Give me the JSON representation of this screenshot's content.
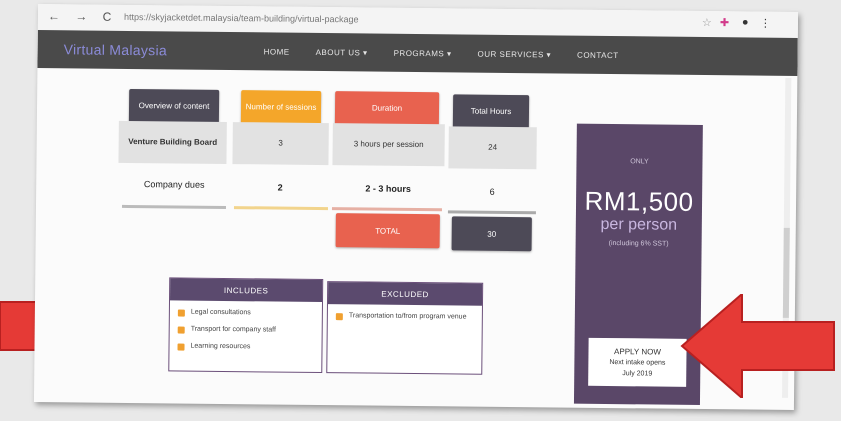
{
  "browser": {
    "url": "https://skyjacketdet.malaysia/team-building/virtual-package",
    "nav_glyphs": "← → C",
    "ext_icons": [
      "star-icon",
      "puzzle-icon",
      "profile-icon",
      "menu-icon"
    ]
  },
  "site": {
    "logo": "Virtual Malaysia",
    "menu": [
      "HOME",
      "ABOUT US ▾",
      "PROGRAMS ▾",
      "OUR SERVICES ▾",
      "CONTACT"
    ]
  },
  "table": {
    "headers": [
      "Overview of content",
      "Number of sessions",
      "Duration",
      "Total Hours"
    ],
    "row1": [
      "Venture Building Board",
      "3",
      "3 hours per session",
      "24"
    ],
    "row2": [
      "Company dues",
      "2",
      "2 - 3 hours",
      "6"
    ],
    "total_label": "TOTAL",
    "total_value": "30"
  },
  "includes": {
    "title": "INCLUDES",
    "items": [
      "Legal consultations",
      "Transport for company staff",
      "Learning resources"
    ]
  },
  "excludes": {
    "title": "EXCLUDED",
    "items": [
      "Transportation to/from program venue"
    ]
  },
  "price": {
    "only": "ONLY",
    "amount": "RM1,500",
    "per": "per person",
    "incl": "(including 6% SST)",
    "apply": "APPLY NOW",
    "note1": "Next intake opens",
    "note2": "July 2019"
  },
  "colors": {
    "col1": "#4d4a57",
    "col2": "#f4a62a",
    "col3": "#e8624f",
    "col4": "#4d4a57",
    "arrow": "#e53a36"
  }
}
